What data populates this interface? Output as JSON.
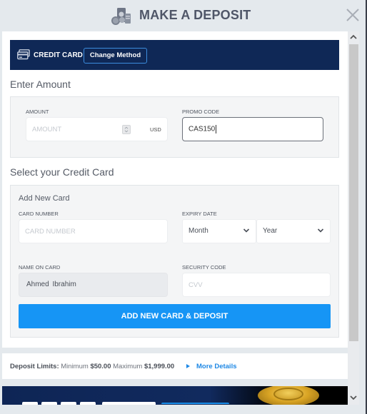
{
  "header": {
    "title": "MAKE A DEPOSIT",
    "icon": "money-deposit-icon",
    "close_icon": "close-icon"
  },
  "payment_method": {
    "icon": "credit-card-icon",
    "label": "CREDIT CARD",
    "change_button": "Change Method"
  },
  "amount_section": {
    "title": "Enter Amount",
    "amount_label": "AMOUNT",
    "amount_placeholder": "AMOUNT",
    "amount_value": "",
    "currency": "USD",
    "promo_label": "PROMO CODE",
    "promo_value": "CAS150"
  },
  "card_section": {
    "title": "Select your Credit Card",
    "subtitle": "Add New Card",
    "card_number_label": "CARD NUMBER",
    "card_number_placeholder": "CARD NUMBER",
    "expiry_label": "EXPIRY DATE",
    "month_selected": "Month",
    "year_selected": "Year",
    "name_label": "NAME ON CARD",
    "name_value": "Ahmed  Ibrahim",
    "security_label": "SECURITY CODE",
    "security_placeholder": "CVV",
    "submit_button": "ADD NEW CARD & DEPOSIT"
  },
  "limits": {
    "label": "Deposit Limits:",
    "min_label": "Minimum",
    "min_value": "$50.00",
    "max_label": "Maximum",
    "max_value": "$1,999.00",
    "more_link": "More Details"
  },
  "colors": {
    "navy": "#0f2856",
    "primary": "#1695f5",
    "link": "#1e88e5",
    "title_gray": "#4f5668"
  }
}
